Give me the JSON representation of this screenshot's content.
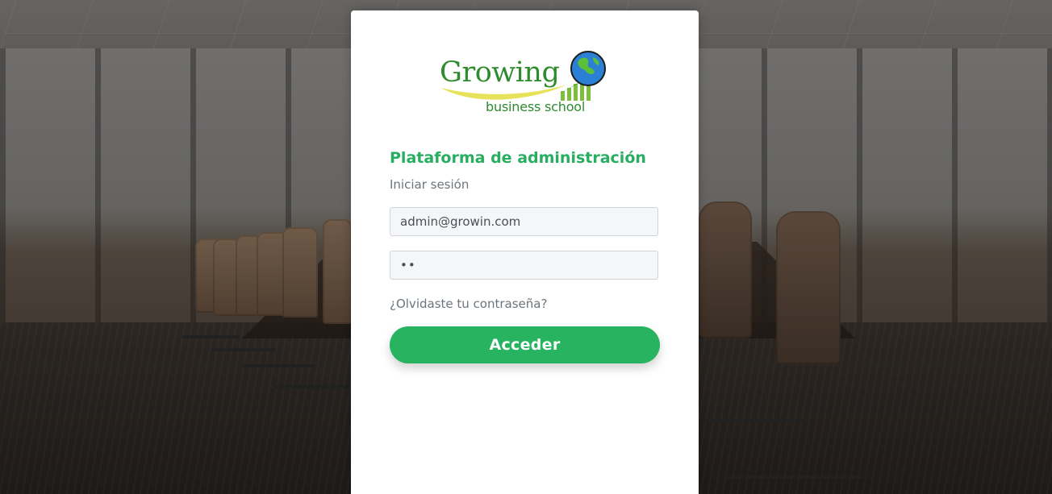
{
  "brand": {
    "logo_word": "Growing",
    "logo_tagline": "business school",
    "logo_color": "#2e8b2e",
    "accent": "#27ae60",
    "icons": [
      "globe-icon",
      "growth-bars-icon",
      "swoosh-icon"
    ]
  },
  "login": {
    "title": "Plataforma de administración",
    "subtitle": "Iniciar sesión",
    "email_value": "admin@growin.com",
    "password_value": "••",
    "forgot_link": "¿Olvidaste tu contraseña?",
    "submit_label": "Acceder"
  }
}
